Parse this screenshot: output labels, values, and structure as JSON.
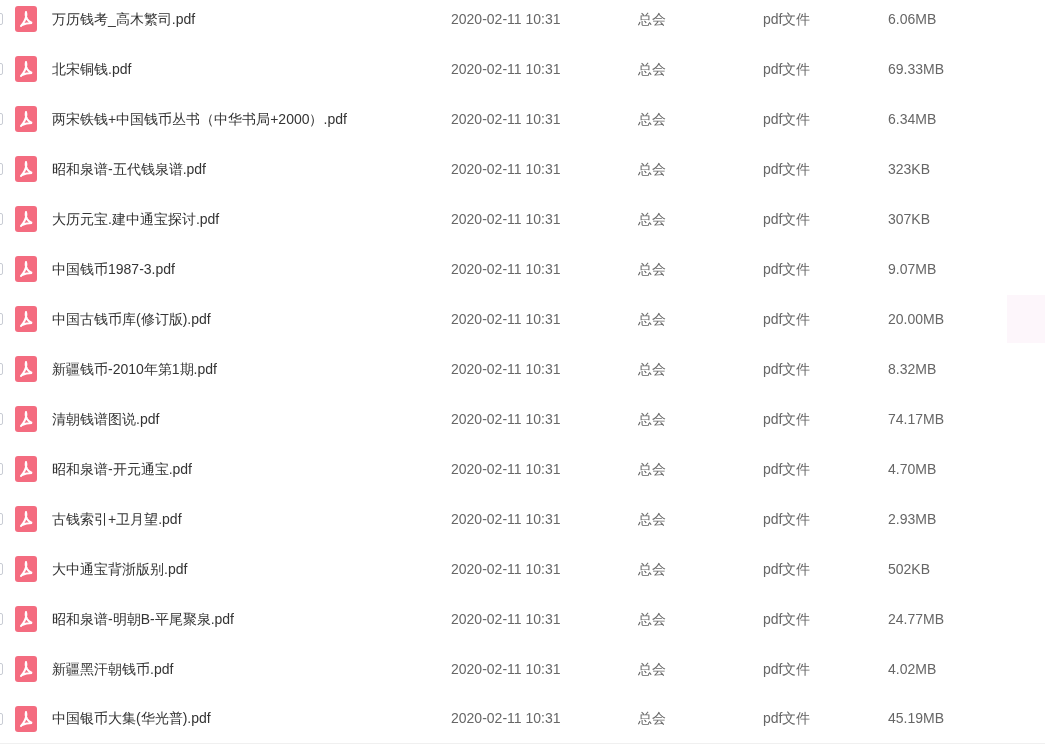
{
  "files": [
    {
      "name": "万历钱考_高木繁司.pdf",
      "modified": "2020-02-11 10:31",
      "owner": "总会",
      "type": "pdf文件",
      "size": "6.06MB",
      "checked": false
    },
    {
      "name": "北宋铜钱.pdf",
      "modified": "2020-02-11 10:31",
      "owner": "总会",
      "type": "pdf文件",
      "size": "69.33MB",
      "checked": false
    },
    {
      "name": "两宋铁钱+中国钱币丛书（中华书局+2000）.pdf",
      "modified": "2020-02-11 10:31",
      "owner": "总会",
      "type": "pdf文件",
      "size": "6.34MB",
      "checked": false
    },
    {
      "name": "昭和泉谱-五代钱泉谱.pdf",
      "modified": "2020-02-11 10:31",
      "owner": "总会",
      "type": "pdf文件",
      "size": "323KB",
      "checked": false
    },
    {
      "name": "大历元宝.建中通宝探讨.pdf",
      "modified": "2020-02-11 10:31",
      "owner": "总会",
      "type": "pdf文件",
      "size": "307KB",
      "checked": false
    },
    {
      "name": "中国钱币1987-3.pdf",
      "modified": "2020-02-11 10:31",
      "owner": "总会",
      "type": "pdf文件",
      "size": "9.07MB",
      "checked": false
    },
    {
      "name": "中国古钱币库(修订版).pdf",
      "modified": "2020-02-11 10:31",
      "owner": "总会",
      "type": "pdf文件",
      "size": "20.00MB",
      "checked": false
    },
    {
      "name": "新疆钱币-2010年第1期.pdf",
      "modified": "2020-02-11 10:31",
      "owner": "总会",
      "type": "pdf文件",
      "size": "8.32MB",
      "checked": false
    },
    {
      "name": "清朝钱谱图说.pdf",
      "modified": "2020-02-11 10:31",
      "owner": "总会",
      "type": "pdf文件",
      "size": "74.17MB",
      "checked": false
    },
    {
      "name": "昭和泉谱-开元通宝.pdf",
      "modified": "2020-02-11 10:31",
      "owner": "总会",
      "type": "pdf文件",
      "size": "4.70MB",
      "checked": false
    },
    {
      "name": "古钱索引+卫月望.pdf",
      "modified": "2020-02-11 10:31",
      "owner": "总会",
      "type": "pdf文件",
      "size": "2.93MB",
      "checked": false
    },
    {
      "name": "大中通宝背浙版别.pdf",
      "modified": "2020-02-11 10:31",
      "owner": "总会",
      "type": "pdf文件",
      "size": "502KB",
      "checked": false
    },
    {
      "name": "昭和泉谱-明朝B-平尾聚泉.pdf",
      "modified": "2020-02-11 10:31",
      "owner": "总会",
      "type": "pdf文件",
      "size": "24.77MB",
      "checked": false
    },
    {
      "name": "新疆黑汗朝钱币.pdf",
      "modified": "2020-02-11 10:31",
      "owner": "总会",
      "type": "pdf文件",
      "size": "4.02MB",
      "checked": false
    },
    {
      "name": "中国银币大集(华光普).pdf",
      "modified": "2020-02-11 10:31",
      "owner": "总会",
      "type": "pdf文件",
      "size": "45.19MB",
      "checked": false
    }
  ]
}
